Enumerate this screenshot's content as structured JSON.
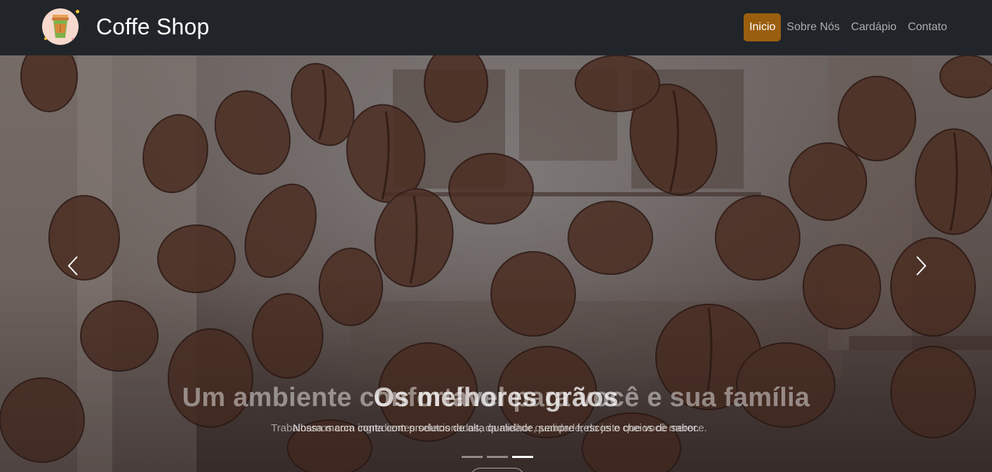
{
  "brand": {
    "title": "Coffe Shop",
    "logo_icon": "coffee-cup-icon"
  },
  "nav": {
    "items": [
      {
        "label": "Inicio",
        "active": true
      },
      {
        "label": "Sobre Nós",
        "active": false
      },
      {
        "label": "Cardápio",
        "active": false
      },
      {
        "label": "Contato",
        "active": false
      }
    ]
  },
  "hero": {
    "slides": [
      {
        "title": "Um ambiente confortável para você e sua família",
        "text": "Trabalhamos com ingredientes selecionados, da melhor qualidade, do jeito que você merece."
      },
      {
        "title": "Os melhores grãos",
        "text": "Nossa marca conta com produtos de alta qualidade, sempre frescos e cheios de sabor."
      }
    ],
    "indicators": 3,
    "active_indicator": 2,
    "prev_icon": "chevron-left-icon",
    "next_icon": "chevron-right-icon"
  },
  "colors": {
    "navbar": "#212529",
    "accent": "#9a5e0f"
  }
}
